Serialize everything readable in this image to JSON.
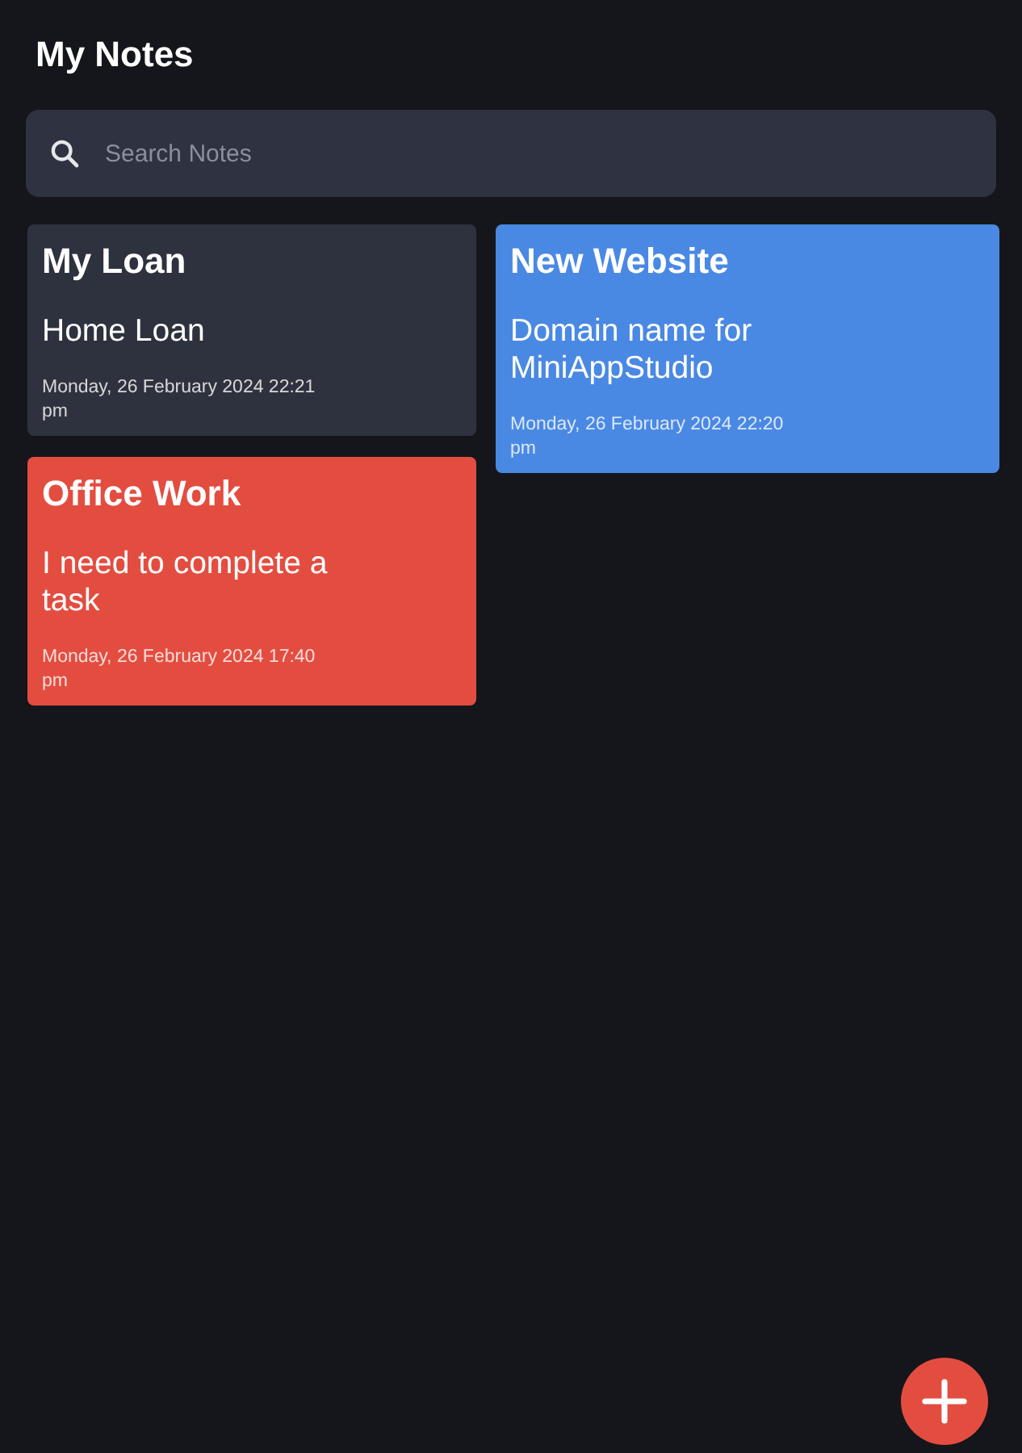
{
  "header": {
    "title": "My Notes"
  },
  "search": {
    "placeholder": "Search Notes"
  },
  "note_columns": [
    {
      "notes": [
        {
          "title": "My Loan",
          "body": "Home Loan",
          "date": "Monday, 26 February 2024 22:21 pm",
          "color": "#2e323e"
        },
        {
          "title": "Office Work",
          "body": "I need to complete a task",
          "date": "Monday, 26 February 2024 17:40 pm",
          "color": "#e34d40"
        }
      ]
    },
    {
      "notes": [
        {
          "title": "New Website",
          "body": "Domain name for MiniAppStudio",
          "date": "Monday, 26 February 2024 22:20 pm",
          "color": "#4a89e3"
        }
      ]
    }
  ],
  "add_button": {
    "kind": "fab"
  }
}
